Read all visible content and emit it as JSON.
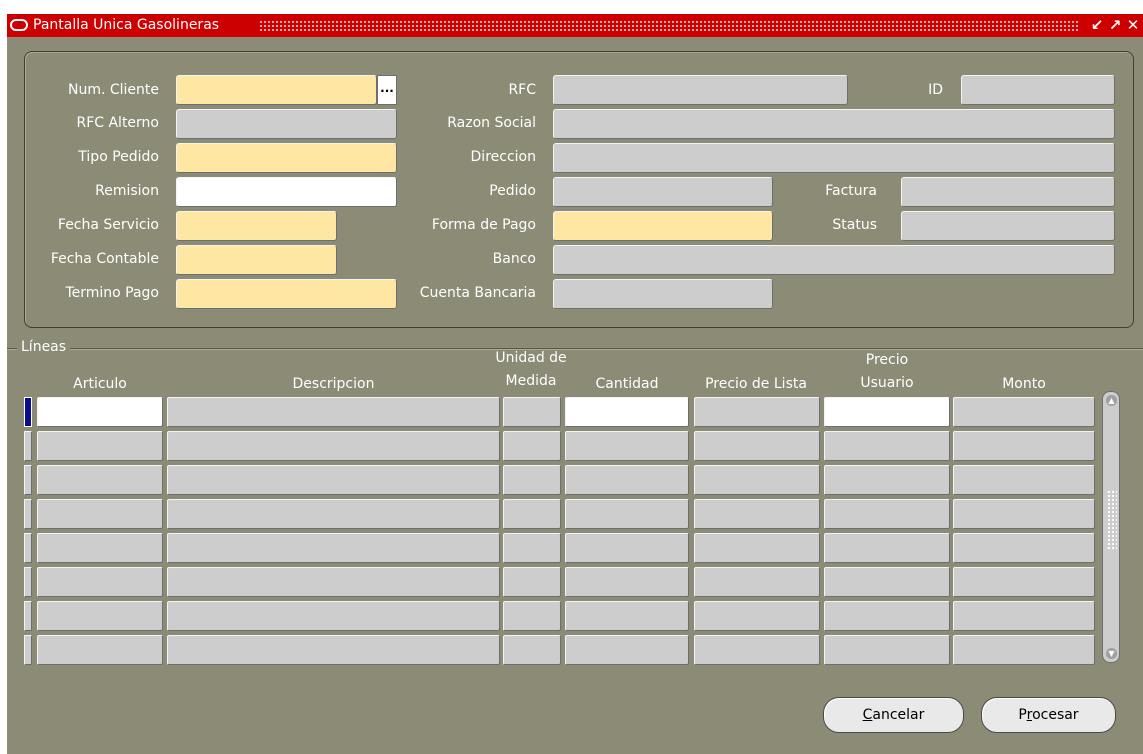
{
  "window": {
    "title": "Pantalla Unica Gasolineras"
  },
  "header": {
    "labels": {
      "num_cliente": "Num. Cliente",
      "rfc_alterno": "RFC Alterno",
      "tipo_pedido": "Tipo Pedido",
      "remision": "Remision",
      "fecha_servicio": "Fecha Servicio",
      "fecha_contable": "Fecha Contable",
      "termino_pago": "Termino Pago",
      "rfc": "RFC",
      "razon_social": "Razon Social",
      "direccion": "Direccion",
      "pedido": "Pedido",
      "forma_pago": "Forma de Pago",
      "banco": "Banco",
      "cuenta_bancaria": "Cuenta Bancaria",
      "id": "ID",
      "factura": "Factura",
      "status": "Status"
    },
    "values": {
      "num_cliente": "",
      "rfc_alterno": "",
      "tipo_pedido": "",
      "remision": "",
      "fecha_servicio": "",
      "fecha_contable": "",
      "termino_pago": "",
      "rfc": "",
      "razon_social": "",
      "direccion": "",
      "pedido": "",
      "forma_pago": "",
      "banco": "",
      "cuenta_bancaria": "",
      "id": "",
      "factura": "",
      "status": ""
    },
    "lov_button": "..."
  },
  "lines": {
    "section_title": "Líneas",
    "columns": {
      "articulo": "Articulo",
      "descripcion": "Descripcion",
      "unidad_line1": "Unidad de",
      "unidad_line2": "Medida",
      "cantidad": "Cantidad",
      "precio_lista": "Precio de Lista",
      "precio_usuario_line1": "Precio",
      "precio_usuario_line2": "Usuario",
      "monto": "Monto"
    }
  },
  "buttons": {
    "cancelar_mnemonic": "C",
    "cancelar_rest": "ancelar",
    "procesar_prefix": "P",
    "procesar_mnemonic": "r",
    "procesar_rest": "ocesar"
  },
  "colors": {
    "background": "#8c8c76",
    "titlebar": "#cc0000",
    "required_field": "#fde7a2",
    "readonly_field": "#cdcdcd",
    "editable_field": "#ffffff"
  }
}
